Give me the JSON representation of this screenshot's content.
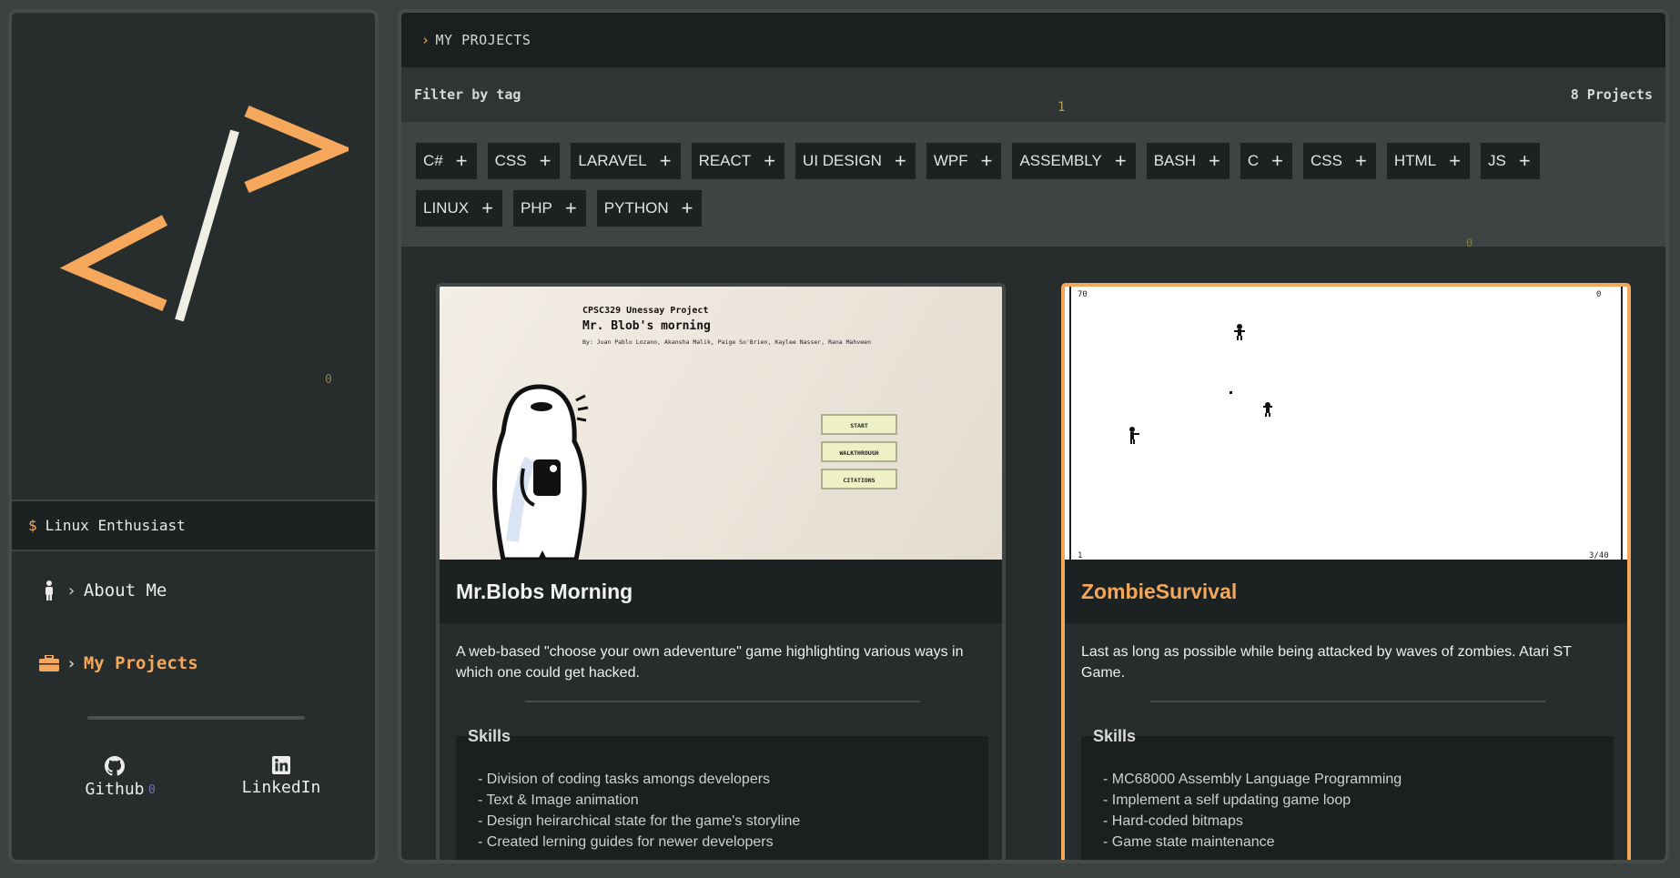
{
  "colors": {
    "accent": "#f5a85b",
    "panel": "#272d2c",
    "dark": "#1c2221"
  },
  "sidebar": {
    "logo_icon": "code-slash-logo",
    "stray_num": "0",
    "tagline_prompt": "$",
    "tagline": "Linux Enthusiast",
    "nav": [
      {
        "icon": "person-icon",
        "label": "About Me",
        "active": false
      },
      {
        "icon": "briefcase-icon",
        "label": "My Projects",
        "active": true
      }
    ],
    "social": [
      {
        "icon": "github-icon",
        "label": "Github",
        "badge": "0"
      },
      {
        "icon": "linkedin-icon",
        "label": "LinkedIn"
      }
    ]
  },
  "main": {
    "breadcrumb": "MY PROJECTS",
    "filter_label": "Filter by tag",
    "filter_marker": "1",
    "project_count": "8 Projects",
    "tag_marker": "0",
    "tags": [
      "C#",
      "CSS",
      "LARAVEL",
      "REACT",
      "UI DESIGN",
      "WPF",
      "ASSEMBLY",
      "BASH",
      "C",
      "CSS",
      "HTML",
      "JS",
      "LINUX",
      "PHP",
      "PYTHON"
    ],
    "projects": [
      {
        "title": "Mr.Blobs Morning",
        "description": "A web-based \"choose your own adeventure\" game highlighting various ways in which one could get hacked.",
        "skills_title": "Skills",
        "skills": [
          "- Division of coding tasks amongs developers",
          "- Text & Image animation",
          "- Design heirarchical state for the game's storyline",
          "- Created lerning guides for newer developers"
        ],
        "preview": {
          "course": "CPSC329 Unessay Project",
          "title": "Mr. Blob's morning",
          "authors": "By: Juan Pablo Lozano, Akansha Malik, Paige So'Brien, Kaylee Nasser, Rana Mahveen",
          "buttons": [
            "START",
            "WALKTHROUGH",
            "CITATIONS"
          ]
        }
      },
      {
        "title": "ZombieSurvival",
        "description": "Last as long as possible while being attacked by waves of zombies. Atari ST Game.",
        "skills_title": "Skills",
        "skills": [
          "- MC68000 Assembly Language Programming",
          "- Implement a self updating game loop",
          "- Hard-coded bitmaps",
          "- Game state maintenance"
        ],
        "preview": {
          "score_left": "70",
          "score_right": "0",
          "level": "1",
          "ammo": "3/40"
        }
      }
    ]
  }
}
